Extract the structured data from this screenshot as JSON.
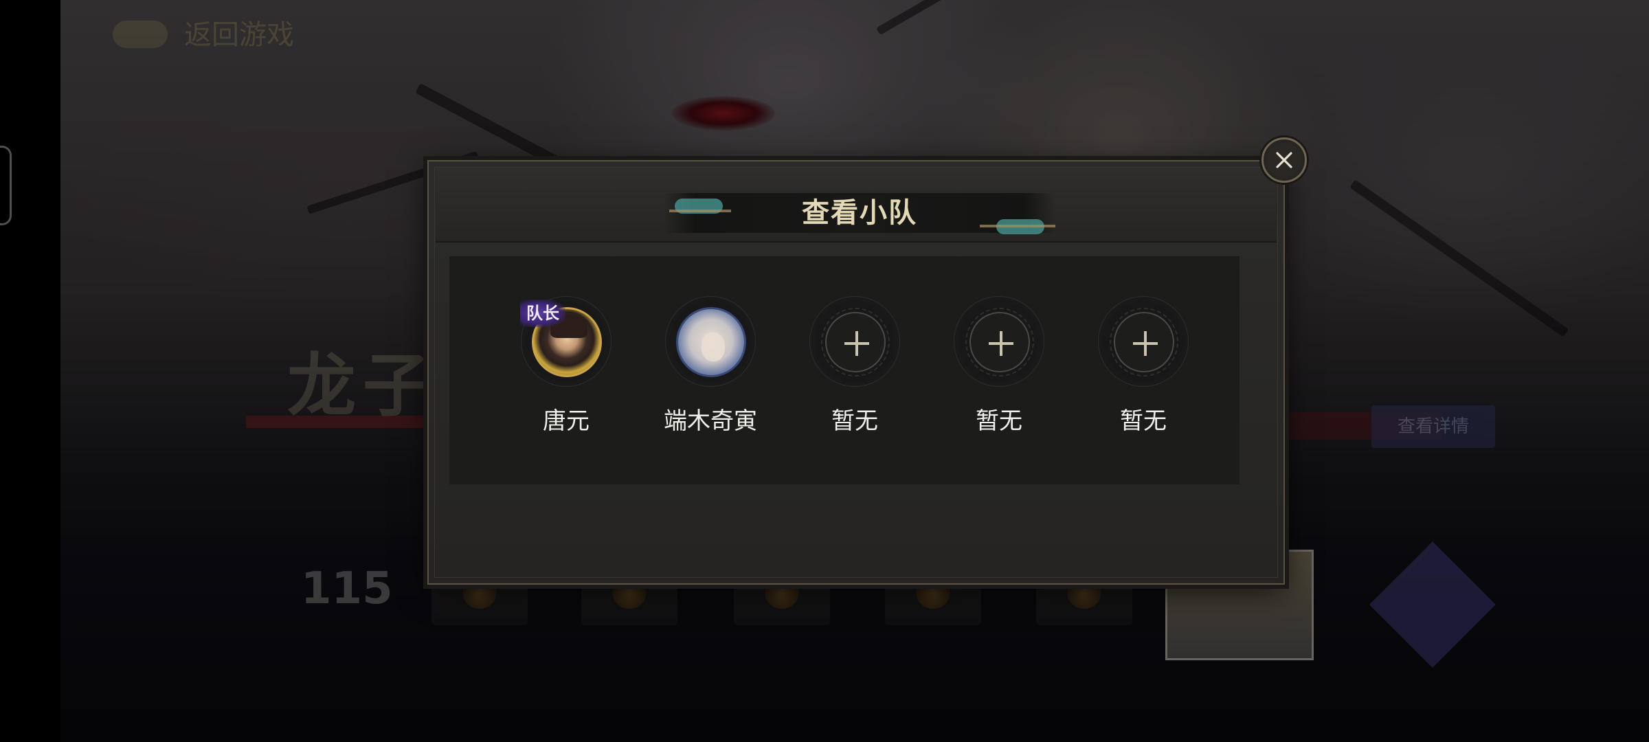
{
  "background": {
    "back_label": "返回游戏",
    "title_text": "龙子",
    "score": "115",
    "right_button": "查看详情"
  },
  "dialog": {
    "title": "查看小队",
    "close_icon": "close-icon",
    "members": [
      {
        "name": "唐元",
        "captain_badge": "队长",
        "filled": true
      },
      {
        "name": "端木奇寅",
        "filled": true
      },
      {
        "name": "暂无",
        "filled": false
      },
      {
        "name": "暂无",
        "filled": false
      },
      {
        "name": "暂无",
        "filled": false
      }
    ]
  },
  "colors": {
    "title_gold": "#e4d9b7",
    "panel": "#1c1c1b",
    "dialog": "#2c2b29",
    "accent_teal": "#4a9e98"
  }
}
